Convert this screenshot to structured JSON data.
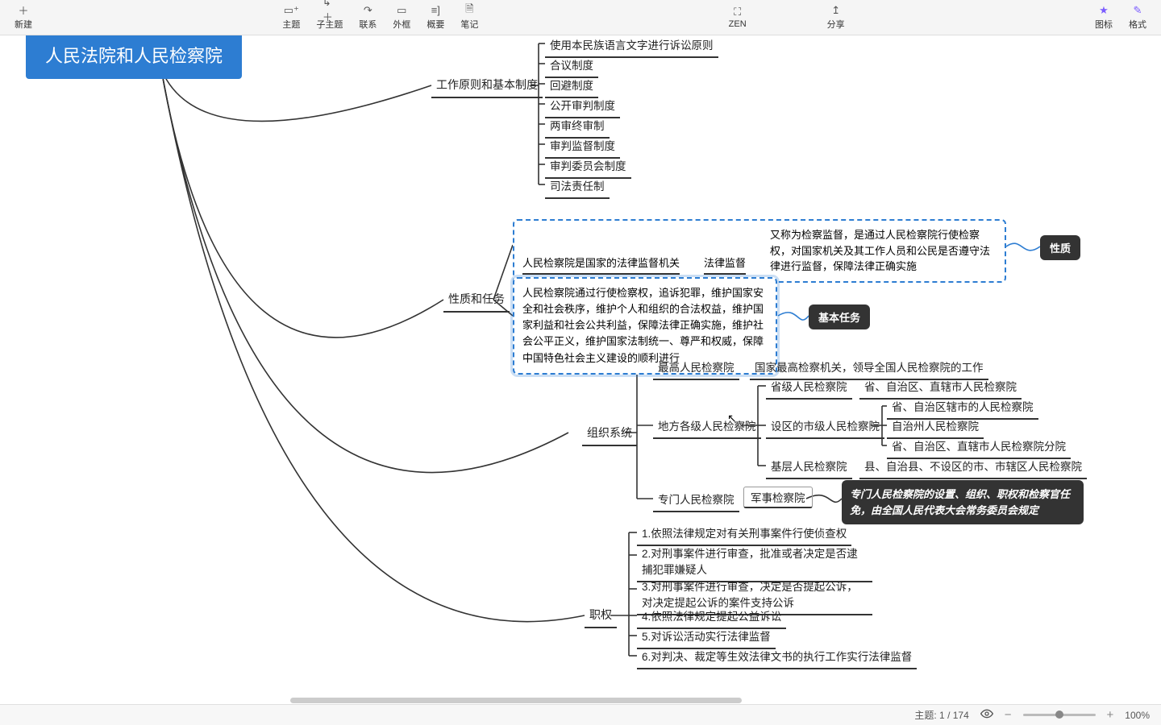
{
  "toolbar": {
    "new": "新建",
    "topic": "主题",
    "subtopic": "子主题",
    "relation": "联系",
    "boundary": "外框",
    "summary": "概要",
    "notes": "笔记",
    "zen": "ZEN",
    "share": "分享",
    "marker": "图标",
    "format": "格式"
  },
  "root": "人民法院和人民检察院",
  "b1": {
    "label": "工作原则和基本制度",
    "items": [
      "使用本民族语言文字进行诉讼原则",
      "合议制度",
      "回避制度",
      "公开审判制度",
      "两审终审制",
      "审判监督制度",
      "审判委员会制度",
      "司法责任制"
    ]
  },
  "b2": {
    "label": "性质和任务",
    "row1_a": "人民检察院是国家的法律监督机关",
    "row1_b": "法律监督",
    "row1_c": "又称为检察监督，是通过人民检察院行使检察权，对国家机关及其工作人员和公民是否遵守法律进行监督，保障法律正确实施",
    "row1_callout": "性质",
    "row2": "人民检察院通过行使检察权，追诉犯罪，维护国家安全和社会秩序，维护个人和组织的合法权益，维护国家利益和社会公共利益，保障法律正确实施，维护社会公平正义，维护国家法制统一、尊严和权威，保障中国特色社会主义建设的顺利进行",
    "row2_callout": "基本任务"
  },
  "b3": {
    "label": "组织系统",
    "supreme": {
      "a": "最高人民检察院",
      "b": "国家最高检察机关，领导全国人民检察院的工作"
    },
    "local": {
      "label": "地方各级人民检察院",
      "prov": {
        "a": "省级人民检察院",
        "b": "省、自治区、直辖市人民检察院"
      },
      "city": {
        "a": "设区的市级人民检察院",
        "items": [
          "省、自治区辖市的人民检察院",
          "自治州人民检察院",
          "省、自治区、直辖市人民检察院分院"
        ]
      },
      "base": {
        "a": "基层人民检察院",
        "b": "县、自治县、不设区的市、市辖区人民检察院"
      }
    },
    "special": {
      "a": "专门人民检察院",
      "b": "军事检察院",
      "callout": "专门人民检察院的设置、组织、职权和检察官任免，由全国人民代表大会常务委员会规定"
    }
  },
  "b4": {
    "label": "职权",
    "items": [
      "1.依照法律规定对有关刑事案件行使侦查权",
      "2.对刑事案件进行审查，批准或者决定是否逮捕犯罪嫌疑人",
      "3.对刑事案件进行审查，决定是否提起公诉，对决定提起公诉的案件支持公诉",
      "4.依照法律规定提起公益诉讼",
      "5.对诉讼活动实行法律监督",
      "6.对判决、裁定等生效法律文书的执行工作实行法律监督"
    ]
  },
  "status": {
    "topics": "主题: 1 / 174",
    "zoom": "100%"
  }
}
